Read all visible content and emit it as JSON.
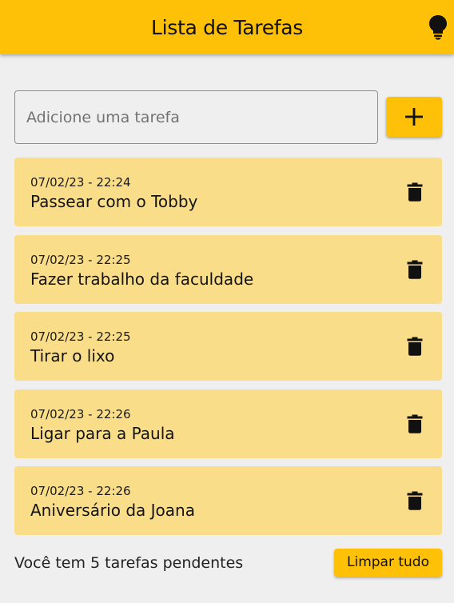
{
  "app": {
    "title": "Lista de Tarefas",
    "accent_color": "#fec107",
    "card_color": "#f9dd89",
    "theme_icon": "lightbulb-icon"
  },
  "input": {
    "placeholder": "Adicione uma tarefa",
    "value": "",
    "add_icon": "plus-icon"
  },
  "tasks": [
    {
      "date": "07/02/23 - 22:24",
      "title": "Passear com o Tobby",
      "delete_icon": "trash-icon"
    },
    {
      "date": "07/02/23 - 22:25",
      "title": "Fazer trabalho da faculdade",
      "delete_icon": "trash-icon"
    },
    {
      "date": "07/02/23 - 22:25",
      "title": "Tirar o lixo",
      "delete_icon": "trash-icon"
    },
    {
      "date": "07/02/23 - 22:26",
      "title": "Ligar para a Paula",
      "delete_icon": "trash-icon"
    },
    {
      "date": "07/02/23 - 22:26",
      "title": "Aniversário da Joana",
      "delete_icon": "trash-icon"
    }
  ],
  "footer": {
    "pending_text": "Você tem 5 tarefas pendentes",
    "clear_label": "Limpar tudo"
  }
}
